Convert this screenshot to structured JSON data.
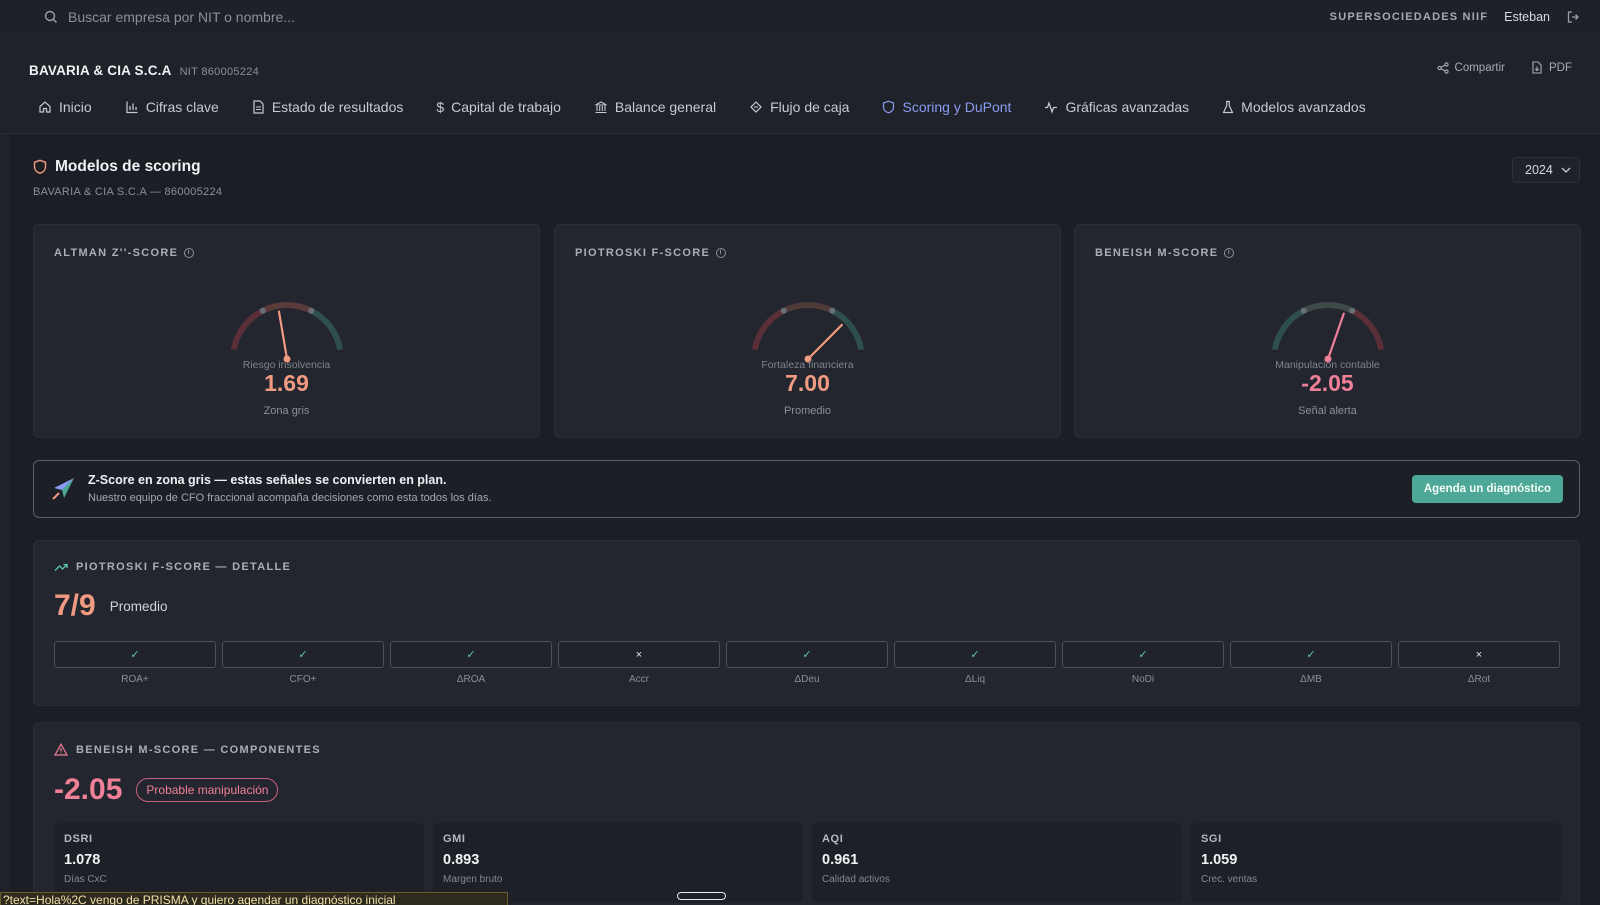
{
  "topbar": {
    "search_placeholder": "Buscar empresa por NIT o nombre...",
    "brand": "SUPERSOCIEDADES NIIF",
    "user": "Esteban"
  },
  "company": {
    "name": "BAVARIA & CIA S.C.A",
    "nit_label": "NIT 860005224"
  },
  "actions": {
    "share": "Compartir",
    "pdf": "PDF"
  },
  "nav": {
    "items": [
      {
        "label": "Inicio",
        "icon": "home-icon"
      },
      {
        "label": "Cifras clave",
        "icon": "bar-chart-icon"
      },
      {
        "label": "Estado de resultados",
        "icon": "document-icon"
      },
      {
        "label": "Capital de trabajo",
        "icon": "dollar-icon"
      },
      {
        "label": "Balance general",
        "icon": "bank-icon"
      },
      {
        "label": "Flujo de caja",
        "icon": "flow-icon"
      },
      {
        "label": "Scoring y DuPont",
        "icon": "shield-icon"
      },
      {
        "label": "Gráficas avanzadas",
        "icon": "activity-icon"
      },
      {
        "label": "Modelos avanzados",
        "icon": "flask-icon"
      }
    ],
    "active": "Scoring y DuPont",
    "active_color": "#8b9cf3"
  },
  "section": {
    "title": "Modelos de scoring",
    "subtitle": "BAVARIA & CIA S.C.A — 860005224",
    "year": "2024"
  },
  "scores": {
    "altman": {
      "label": "ALTMAN Z''-SCORE",
      "caption": "Riesgo insolvencia",
      "value": "1.69",
      "zone": "Zona gris",
      "needle_fraction": 0.44
    },
    "piotroski": {
      "label": "PIOTROSKI F-SCORE",
      "caption": "Fortaleza financiera",
      "value": "7.00",
      "zone": "Promedio",
      "needle_fraction": 0.78
    },
    "beneish": {
      "label": "BENEISH M-SCORE",
      "caption": "Manipulación contable",
      "value": "-2.05",
      "zone": "Señal alerta",
      "needle_fraction": 0.62
    }
  },
  "cta": {
    "title": "Z-Score en zona gris — estas señales se convierten en plan.",
    "subtitle": "Nuestro equipo de CFO fraccional acompaña decisiones como esta todos los días.",
    "button": "Agenda un diagnóstico"
  },
  "piotroski_detail": {
    "label": "PIOTROSKI F-SCORE — DETALLE",
    "score": "7/9",
    "rating": "Promedio",
    "criteria": [
      {
        "name": "ROA+",
        "pass": true,
        "mark": "✓"
      },
      {
        "name": "CFO+",
        "pass": true,
        "mark": "✓"
      },
      {
        "name": "ΔROA",
        "pass": true,
        "mark": "✓"
      },
      {
        "name": "Accr",
        "pass": false,
        "mark": "×"
      },
      {
        "name": "ΔDeu",
        "pass": true,
        "mark": "✓"
      },
      {
        "name": "ΔLiq",
        "pass": true,
        "mark": "✓"
      },
      {
        "name": "NoDi",
        "pass": true,
        "mark": "✓"
      },
      {
        "name": "ΔMB",
        "pass": true,
        "mark": "✓"
      },
      {
        "name": "ΔRot",
        "pass": false,
        "mark": "×"
      }
    ]
  },
  "beneish_detail": {
    "label": "BENEISH M-SCORE — COMPONENTES",
    "score": "-2.05",
    "badge": "Probable manipulación",
    "components": [
      {
        "name": "DSRI",
        "value": "1.078",
        "desc": "Días CxC"
      },
      {
        "name": "GMI",
        "value": "0.893",
        "desc": "Margen bruto"
      },
      {
        "name": "AQI",
        "value": "0.961",
        "desc": "Calidad activos"
      },
      {
        "name": "SGI",
        "value": "1.059",
        "desc": "Crec. ventas"
      }
    ]
  },
  "status_url": "?text=Hola%2C vengo de PRISMA y quiero agendar un diagnóstico inicial",
  "colors": {
    "teal": "#4da897",
    "salmon": "#f19a82",
    "pink": "#f08098",
    "accent": "#8b9cf3"
  }
}
